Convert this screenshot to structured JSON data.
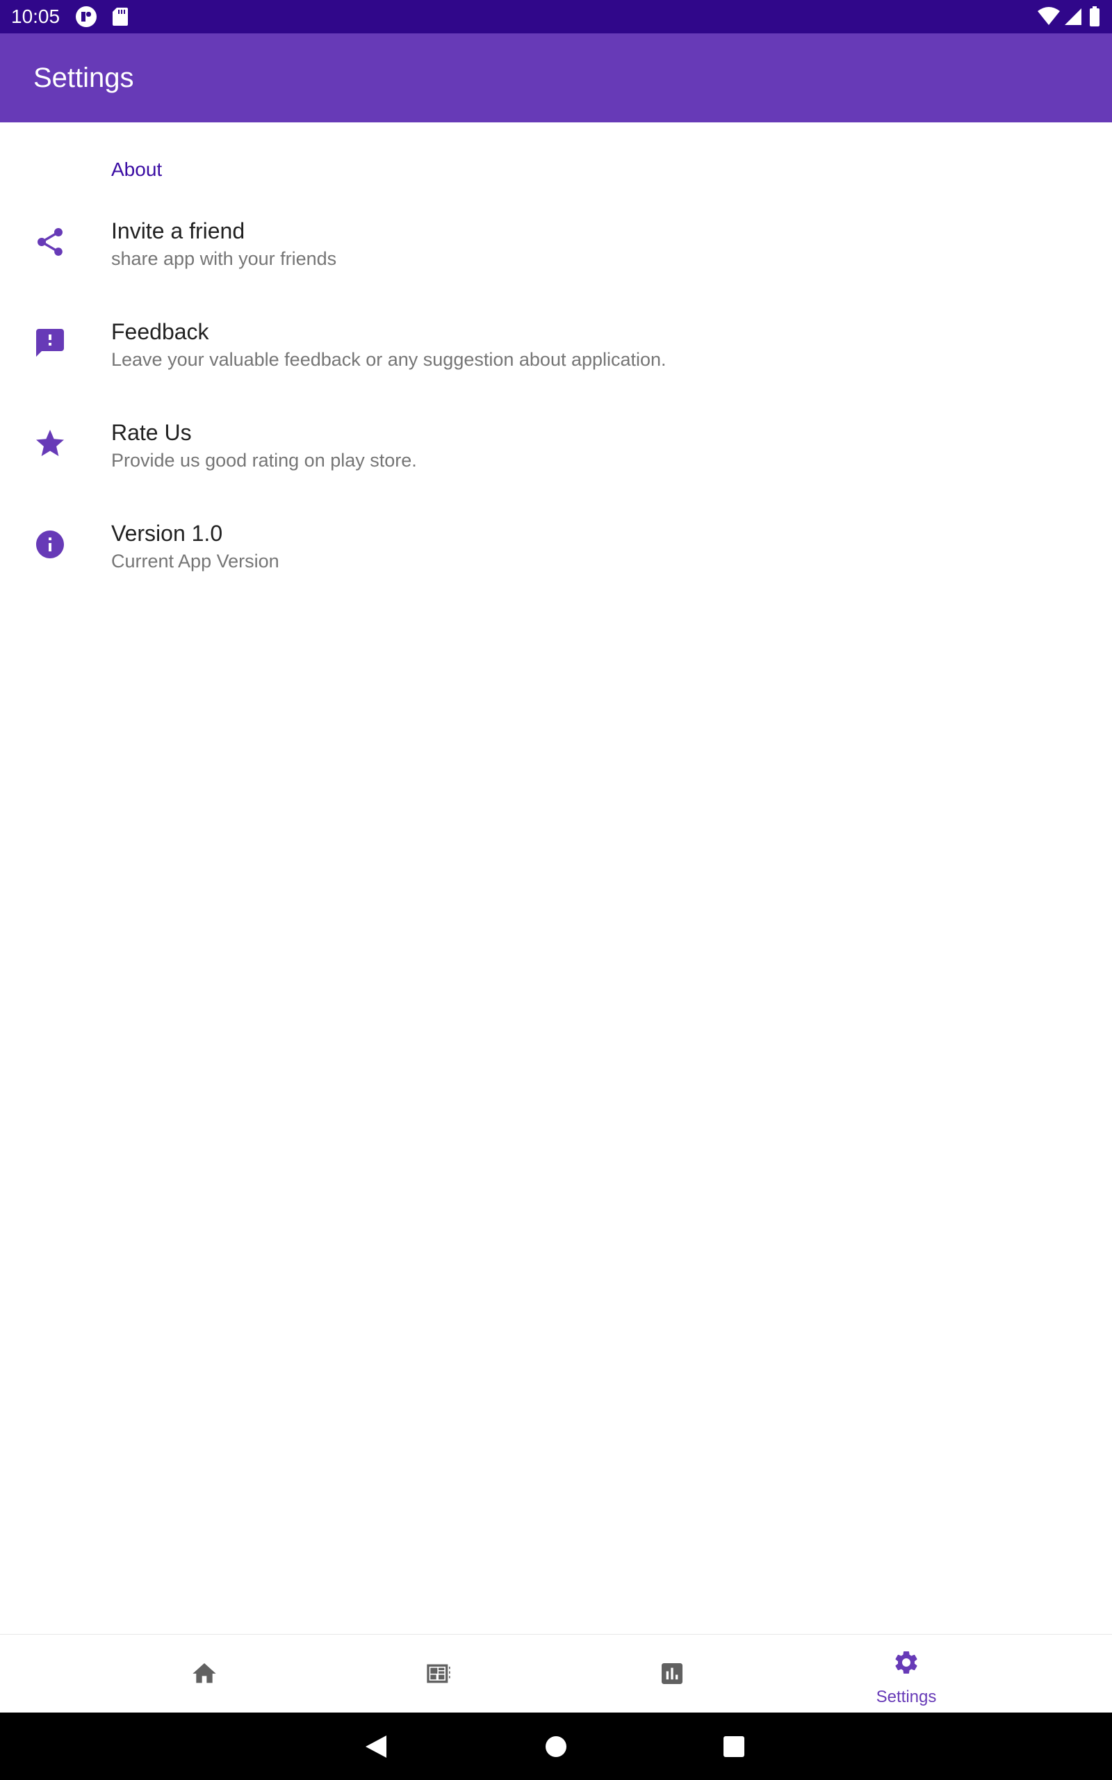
{
  "status_bar": {
    "time": "10:05"
  },
  "app_bar": {
    "title": "Settings"
  },
  "section": {
    "header": "About"
  },
  "items": [
    {
      "icon": "share-icon",
      "title": "Invite a friend",
      "summary": "share app with your friends"
    },
    {
      "icon": "feedback-icon",
      "title": "Feedback",
      "summary": "Leave your valuable feedback or any suggestion about application."
    },
    {
      "icon": "star-icon",
      "title": "Rate Us",
      "summary": "Provide us good rating on play store."
    },
    {
      "icon": "info-icon",
      "title": "Version 1.0",
      "summary": "Current App Version"
    }
  ],
  "bottom_nav": {
    "items": [
      {
        "icon": "home-icon",
        "label": ""
      },
      {
        "icon": "dashboard-icon",
        "label": ""
      },
      {
        "icon": "chart-icon",
        "label": ""
      },
      {
        "icon": "gear-icon",
        "label": "Settings",
        "selected": true
      }
    ]
  },
  "colors": {
    "status_bar": "#30078a",
    "app_bar": "#673ab7",
    "accent": "#673ab7",
    "section_header": "#3a0ca3"
  }
}
